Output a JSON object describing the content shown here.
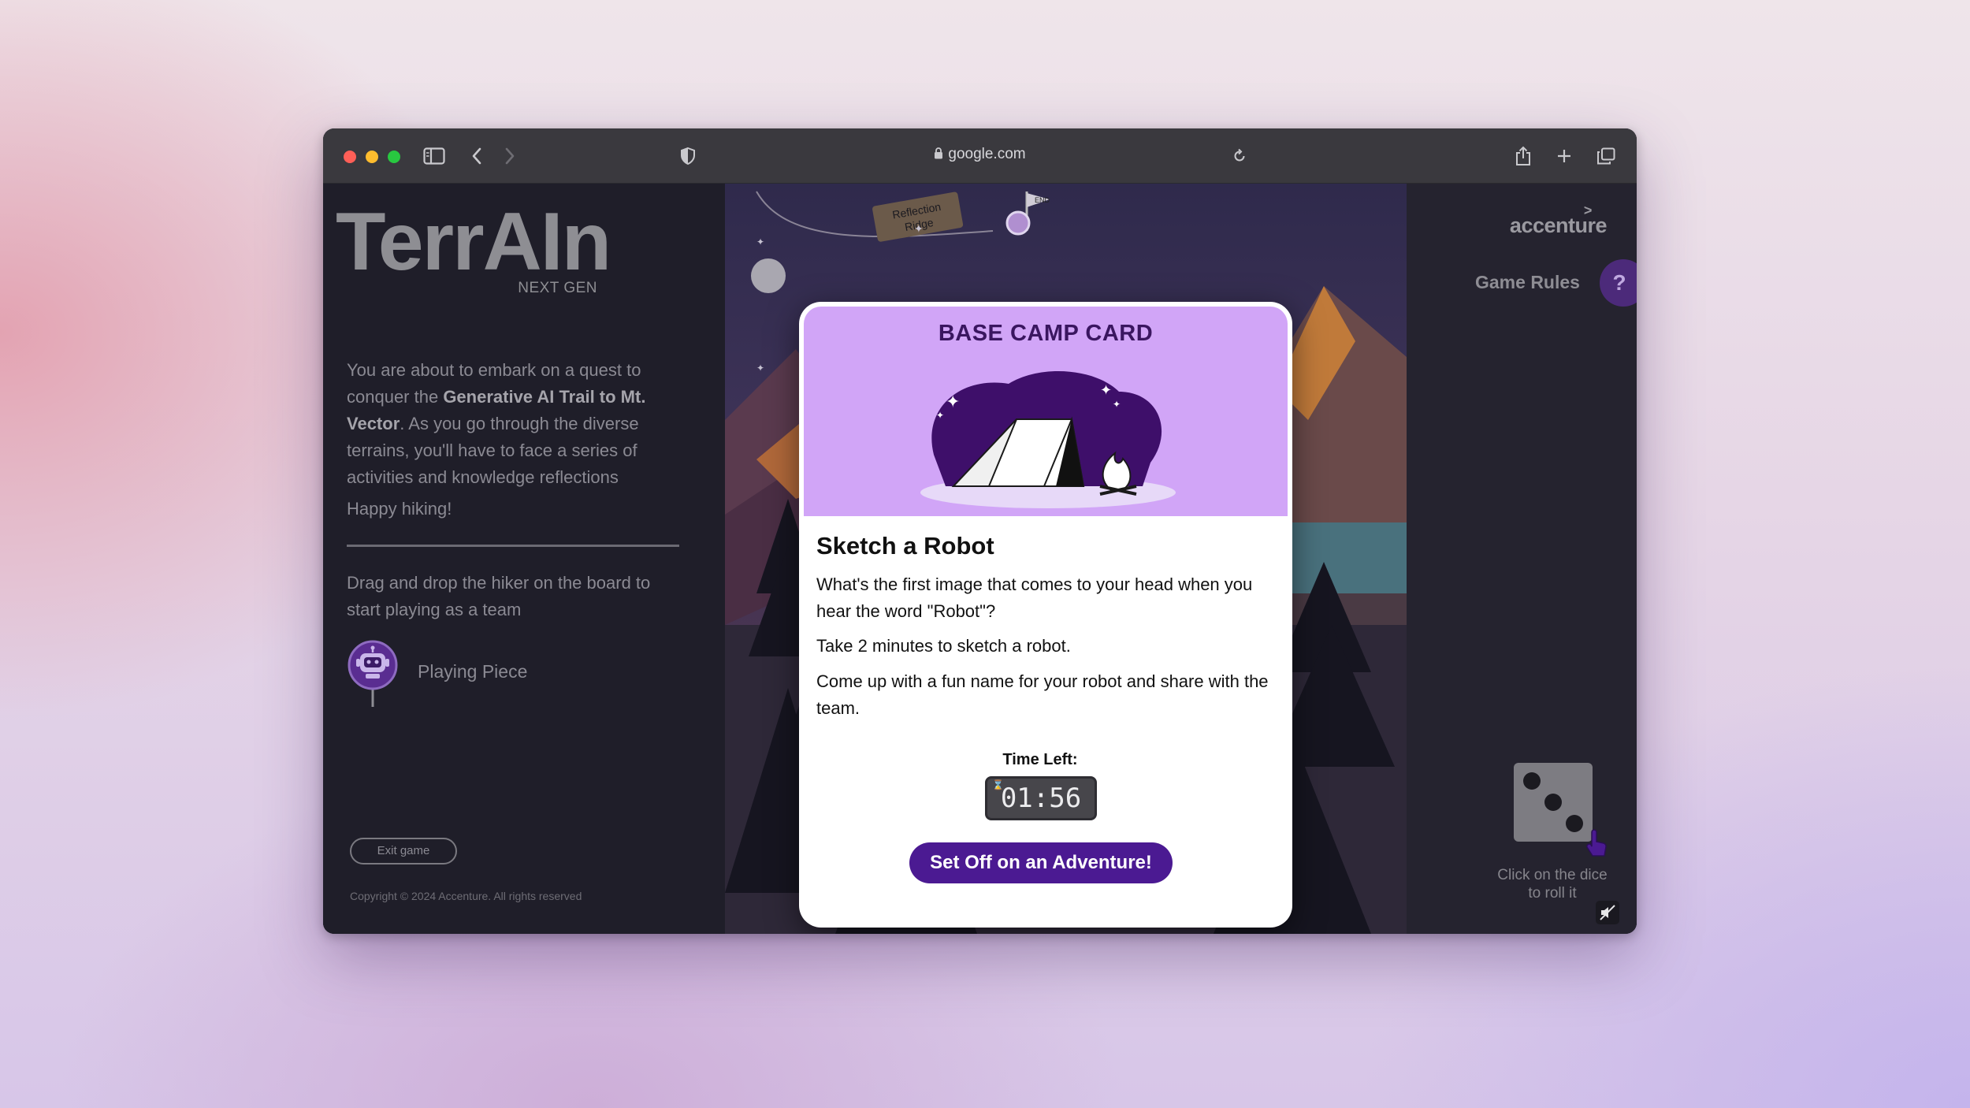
{
  "browser": {
    "url": "google.com"
  },
  "game": {
    "logo": "TerrAIn",
    "logo_sub": "NEXT GEN",
    "intro_prefix": "You are about to embark on a quest to conquer the ",
    "intro_bold": "Generative AI Trail to Mt. Vector",
    "intro_suffix": ". As you go through the diverse terrains, you'll have to face a series of activities and knowledge reflections",
    "happy": "Happy hiking!",
    "drag_hint": "Drag and drop the hiker on the board to start playing as a team",
    "piece_label": "Playing Piece",
    "exit_label": "Exit game",
    "copyright": "Copyright © 2024 Accenture. All rights reserved"
  },
  "board": {
    "sign_line1": "Reflection",
    "sign_line2": "Ridge",
    "flag_label": "END"
  },
  "right": {
    "brand": "accenture",
    "rules_label": "Game Rules",
    "help_label": "?",
    "dice_value": 3,
    "dice_hint_line1": "Click on the dice",
    "dice_hint_line2": "to roll it"
  },
  "modal": {
    "header": "BASE CAMP CARD",
    "title": "Sketch a Robot",
    "text1": "What's the first image that comes to your head when you hear the word \"Robot\"?",
    "text2": "Take 2 minutes to sketch a robot.",
    "text3": "Come up with a fun name for your robot and share with the team.",
    "time_label": "Time Left:",
    "timer": "01:56",
    "timer_glyph": "⌛",
    "cta": "Set Off on an Adventure!"
  },
  "colors": {
    "accent_purple": "#4b1a92",
    "card_header": "#d1a5f7",
    "panel_dark": "#1f1e29"
  }
}
